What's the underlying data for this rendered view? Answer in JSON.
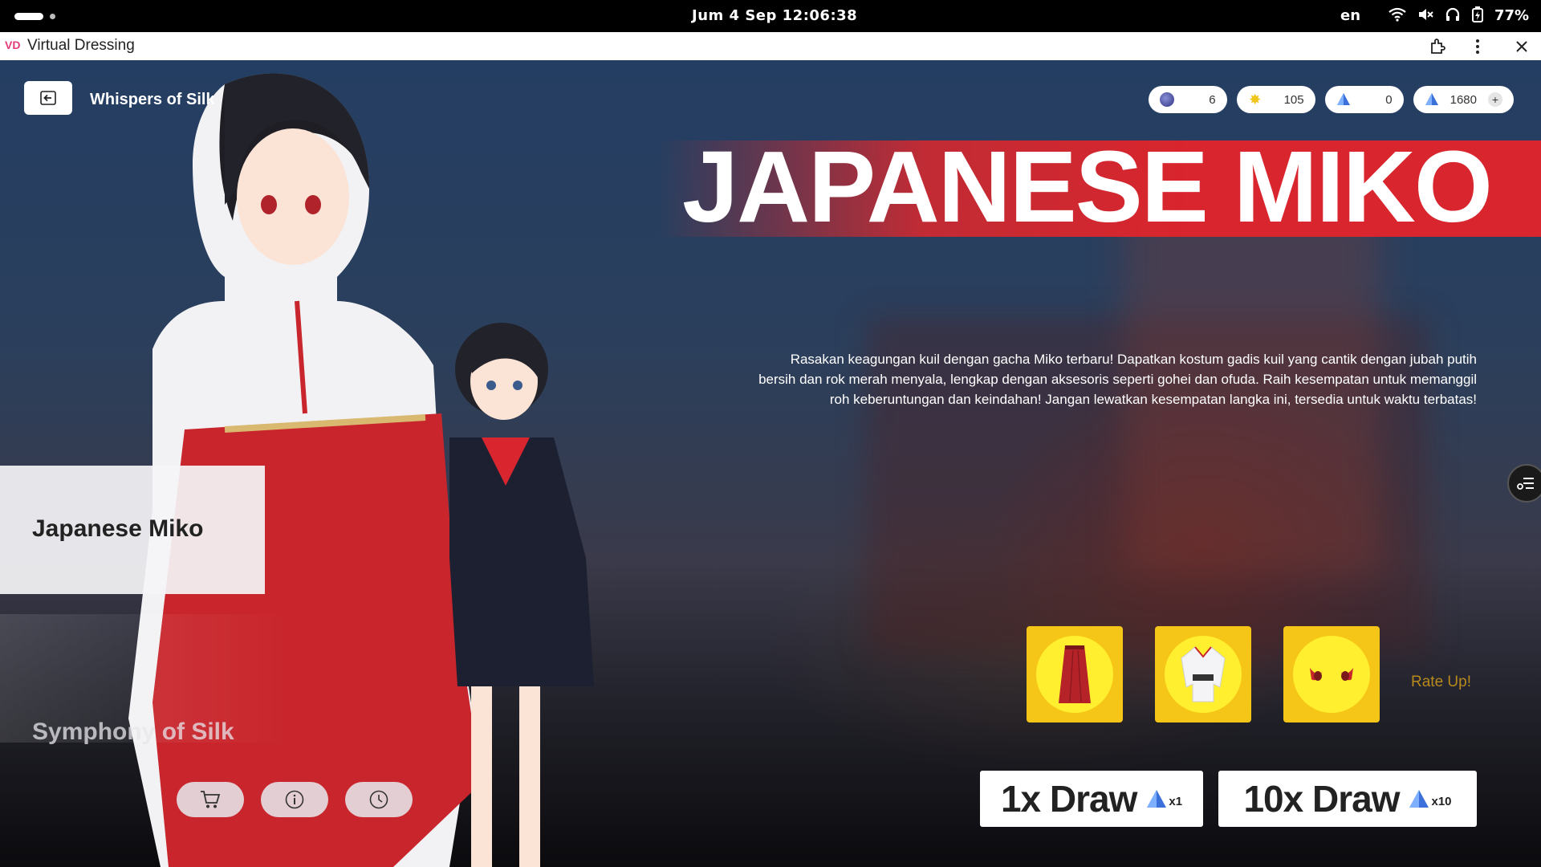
{
  "status_bar": {
    "clock": "Jum   4 Sep  12:06:38",
    "language": "en",
    "battery": "77%"
  },
  "titlebar": {
    "app_logo": "VD",
    "title": "Virtual Dressing"
  },
  "header": {
    "page_name": "Whispers of Silk"
  },
  "currencies": [
    {
      "icon": "gem-icon",
      "value": "6"
    },
    {
      "icon": "star-icon",
      "value": "105"
    },
    {
      "icon": "crystal-icon",
      "value": "0"
    },
    {
      "icon": "crystal-icon",
      "value": "1680",
      "add": "+"
    }
  ],
  "banner": {
    "title": "JAPANESE MIKO",
    "description": "Rasakan keagungan kuil dengan gacha Miko terbaru! Dapatkan kostum gadis kuil yang cantik dengan jubah putih bersih dan rok merah menyala, lengkap dengan aksesoris seperti gohei dan ofuda. Raih kesempatan untuk memanggil roh keberuntungan dan keindahan! Jangan lewatkan kesempatan langka ini, tersedia untuk waktu terbatas!"
  },
  "side_tabs": [
    {
      "label": "Japanese Miko",
      "active": true
    },
    {
      "label": "Symphony of Silk",
      "active": false
    }
  ],
  "bottom_buttons": [
    "cart-icon",
    "info-icon",
    "history-icon"
  ],
  "featured_items": [
    {
      "name": "red-hakama-item"
    },
    {
      "name": "white-kimono-item"
    },
    {
      "name": "face-accessory-item"
    }
  ],
  "rate_up_label": "Rate Up!",
  "draw_buttons": [
    {
      "label": "1x Draw",
      "cost": "x1"
    },
    {
      "label": "10x Draw",
      "cost": "x10"
    }
  ],
  "colors": {
    "banner_red": "#d9252d",
    "item_yellow": "#f5c518",
    "rate_up": "#b8891c"
  }
}
